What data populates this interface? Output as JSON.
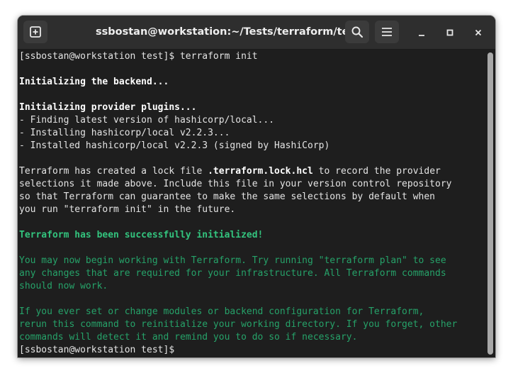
{
  "window": {
    "title": "ssbostan@workstation:~/Tests/terraform/test"
  },
  "icons": {
    "new_tab": "new-tab-plus-icon",
    "search": "magnifier-search-icon",
    "menu": "hamburger-menu-icon",
    "minimize": "minimize-icon",
    "maximize": "maximize-icon",
    "close": "close-x-icon"
  },
  "colors": {
    "terminal_bg": "#1e1e1e",
    "titlebar_bg": "#2e2e2e",
    "success_green": "#26a269"
  },
  "terminal": {
    "lines": [
      {
        "text": "[ssbostan@workstation test]$ terraform init",
        "style": "plain"
      },
      {
        "text": "",
        "style": "plain"
      },
      {
        "text": "Initializing the backend...",
        "style": "bold"
      },
      {
        "text": "",
        "style": "plain"
      },
      {
        "text": "Initializing provider plugins...",
        "style": "bold"
      },
      {
        "text": "- Finding latest version of hashicorp/local...",
        "style": "plain"
      },
      {
        "text": "- Installing hashicorp/local v2.2.3...",
        "style": "plain"
      },
      {
        "text": "- Installed hashicorp/local v2.2.3 (signed by HashiCorp)",
        "style": "plain"
      },
      {
        "text": "",
        "style": "plain"
      },
      {
        "segments": [
          {
            "text": "Terraform has created a lock file ",
            "style": "plain"
          },
          {
            "text": ".terraform.lock.hcl",
            "style": "bold"
          },
          {
            "text": " to record the provider",
            "style": "plain"
          }
        ]
      },
      {
        "text": "selections it made above. Include this file in your version control repository",
        "style": "plain"
      },
      {
        "text": "so that Terraform can guarantee to make the same selections by default when",
        "style": "plain"
      },
      {
        "text": "you run \"terraform init\" in the future.",
        "style": "plain"
      },
      {
        "text": "",
        "style": "plain"
      },
      {
        "text": "Terraform has been successfully initialized!",
        "style": "green-bold"
      },
      {
        "text": "",
        "style": "plain"
      },
      {
        "text": "You may now begin working with Terraform. Try running \"terraform plan\" to see",
        "style": "green"
      },
      {
        "text": "any changes that are required for your infrastructure. All Terraform commands",
        "style": "green"
      },
      {
        "text": "should now work.",
        "style": "green"
      },
      {
        "text": "",
        "style": "plain"
      },
      {
        "text": "If you ever set or change modules or backend configuration for Terraform,",
        "style": "green"
      },
      {
        "text": "rerun this command to reinitialize your working directory. If you forget, other",
        "style": "green"
      },
      {
        "text": "commands will detect it and remind you to do so if necessary.",
        "style": "green"
      },
      {
        "text": "[ssbostan@workstation test]$ ",
        "style": "plain"
      }
    ]
  }
}
